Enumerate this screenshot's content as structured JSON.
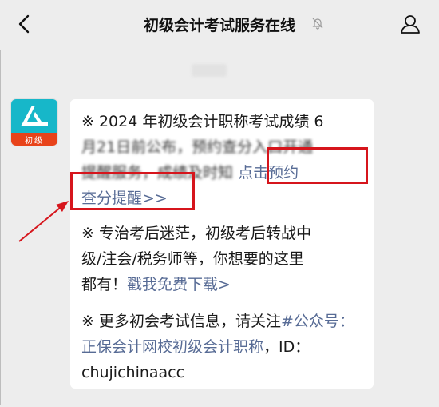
{
  "header": {
    "back_icon": "chevron-left-icon",
    "title": "初级会计考试服务在线",
    "mute_icon": "bell-off-icon",
    "profile_icon": "person-icon"
  },
  "avatar": {
    "label": "初级",
    "colors": {
      "top": "#17b7c9",
      "bottom": "#e8431a"
    }
  },
  "message": {
    "p1_line1": "※ 2024 年初级会计职称考试成绩 6",
    "p1_line2": "月21日前公布，预约查分入口开通",
    "p1_line3_text": "提醒服务，成绩及时知",
    "p1_link1": "点击预约",
    "p1_link2": "查分提醒>>",
    "p2_line1": "※ 专治考后迷茫，初级考后转战中",
    "p2_line2": "级/注会/税务师等，你想要的这里",
    "p2_line3_text": "都有！",
    "p2_link": "戳我免费下载>",
    "p3_line1_text": "※ 更多初会考试信息，请关注",
    "p3_link": "#公众号：正保会计网校初级会计职称",
    "p3_tail": "，ID：chujichinaacc"
  },
  "colors": {
    "link": "#576b95",
    "highlight": "#d6151c",
    "background": "#ededed"
  }
}
